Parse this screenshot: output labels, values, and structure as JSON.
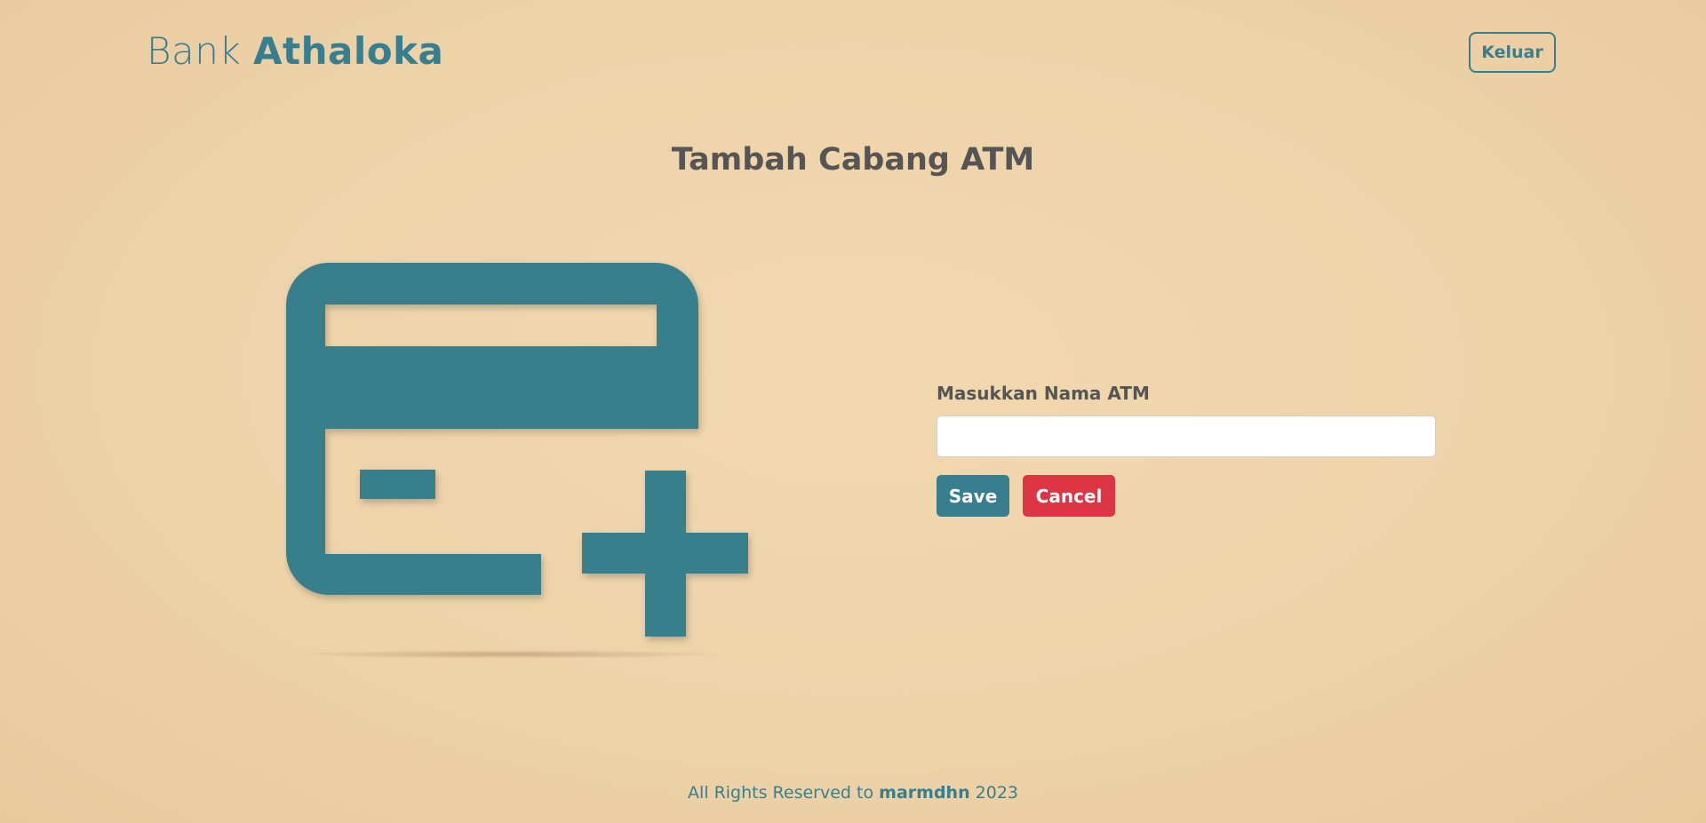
{
  "header": {
    "brand_prefix": "Bank",
    "brand_name": "Athaloka",
    "logout_label": "Keluar"
  },
  "main": {
    "title": "Tambah Cabang ATM",
    "illustration_icon": "add-card-icon",
    "form": {
      "label": "Masukkan Nama ATM",
      "input_value": "",
      "input_placeholder": "",
      "save_label": "Save",
      "cancel_label": "Cancel"
    }
  },
  "footer": {
    "prefix": "All Rights Reserved to",
    "owner": "marmdhn",
    "year": "2023"
  },
  "colors": {
    "primary": "#377f8e",
    "danger": "#dc3545",
    "background": "#eed3a9",
    "text": "#555555"
  }
}
